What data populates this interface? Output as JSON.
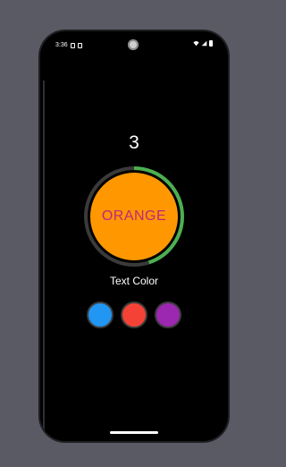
{
  "status_bar": {
    "time": "3:36",
    "left_icons": [
      "sim-icon",
      "notification-icon"
    ],
    "right_icons": [
      "wifi-icon",
      "signal-icon",
      "battery-icon"
    ]
  },
  "game": {
    "counter": "3",
    "color_word": "ORANGE",
    "color_word_text_color": "#c0257f",
    "circle_fill_color": "#ff9800",
    "timer_progress": 0.45,
    "timer_track_color": "#3a3a3a",
    "timer_progress_color": "#4caf50",
    "prompt_label": "Text Color",
    "choices": [
      {
        "name": "blue",
        "color": "#2196f3"
      },
      {
        "name": "red",
        "color": "#f44336"
      },
      {
        "name": "purple",
        "color": "#9c27b0"
      }
    ]
  },
  "colors": {
    "background": "#595a63",
    "screen": "#000000"
  }
}
